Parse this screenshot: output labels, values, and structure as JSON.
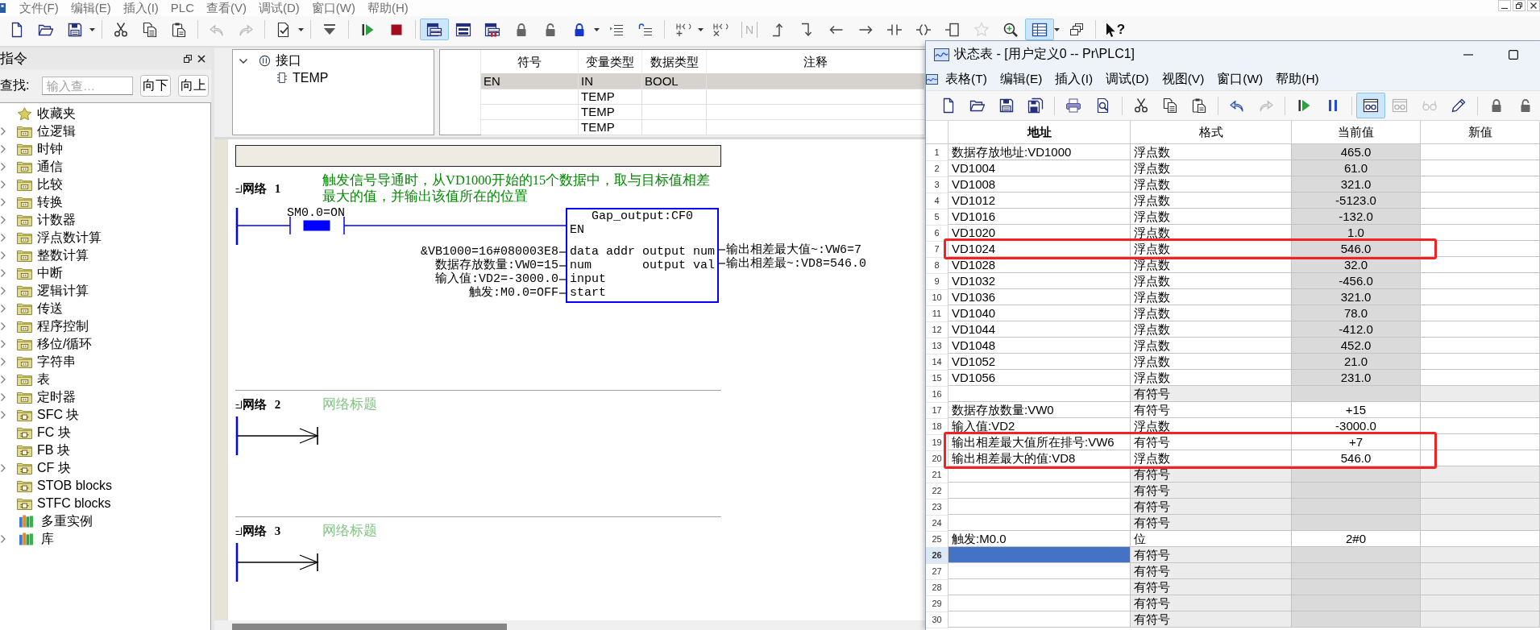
{
  "menu_bar": [
    "文件(F)",
    "编辑(E)",
    "插入(I)",
    "PLC",
    "查看(V)",
    "调试(D)",
    "窗口(W)",
    "帮助(H)"
  ],
  "toolbar": [
    [
      {
        "kind": "new",
        "pressed": false,
        "disabled": false,
        "dropdown": false
      },
      {
        "kind": "open",
        "pressed": false,
        "disabled": false,
        "dropdown": false
      },
      {
        "kind": "save",
        "pressed": false,
        "disabled": false,
        "dropdown": true
      }
    ],
    [
      {
        "kind": "cut",
        "pressed": false,
        "disabled": false,
        "dropdown": false
      },
      {
        "kind": "copy",
        "pressed": false,
        "disabled": false,
        "dropdown": false
      },
      {
        "kind": "paste",
        "pressed": false,
        "disabled": false,
        "dropdown": false
      }
    ],
    [
      {
        "kind": "undo",
        "pressed": false,
        "disabled": true,
        "dropdown": false
      },
      {
        "kind": "redo",
        "pressed": false,
        "disabled": true,
        "dropdown": false
      }
    ],
    [
      {
        "kind": "compile",
        "pressed": false,
        "disabled": false,
        "dropdown": true
      }
    ],
    [
      {
        "kind": "download",
        "pressed": false,
        "disabled": false,
        "dropdown": false
      }
    ],
    [
      {
        "kind": "run",
        "pressed": false,
        "disabled": false,
        "dropdown": false
      },
      {
        "kind": "stop",
        "pressed": false,
        "disabled": false,
        "dropdown": false
      }
    ],
    [
      {
        "kind": "listview",
        "pressed": true,
        "disabled": false,
        "dropdown": false
      },
      {
        "kind": "listview2",
        "pressed": false,
        "disabled": false,
        "dropdown": false
      },
      {
        "kind": "listforce",
        "pressed": false,
        "disabled": false,
        "dropdown": false
      },
      {
        "kind": "lock",
        "pressed": false,
        "disabled": false,
        "dropdown": false
      },
      {
        "kind": "unlock",
        "pressed": false,
        "disabled": false,
        "dropdown": false
      },
      {
        "kind": "protect",
        "pressed": false,
        "disabled": false,
        "dropdown": true
      },
      {
        "kind": "indent",
        "pressed": false,
        "disabled": false,
        "dropdown": false
      },
      {
        "kind": "outdent",
        "pressed": false,
        "disabled": false,
        "dropdown": false
      }
    ],
    [
      {
        "kind": "insertnet",
        "pressed": false,
        "disabled": false,
        "dropdown": true
      },
      {
        "kind": "deletenet",
        "pressed": false,
        "disabled": false,
        "dropdown": false
      },
      {
        "kind": "negate",
        "text": "N",
        "pressed": false,
        "disabled": true,
        "dropdown": false
      },
      {
        "kind": "branchup",
        "pressed": false,
        "disabled": false,
        "dropdown": false
      },
      {
        "kind": "branchdown",
        "pressed": false,
        "disabled": false,
        "dropdown": false
      },
      {
        "kind": "lineleft",
        "pressed": false,
        "disabled": false,
        "dropdown": false
      },
      {
        "kind": "lineright",
        "pressed": false,
        "disabled": false,
        "dropdown": false
      },
      {
        "kind": "contact",
        "pressed": false,
        "disabled": false,
        "dropdown": false
      },
      {
        "kind": "coil",
        "pressed": false,
        "disabled": false,
        "dropdown": false
      },
      {
        "kind": "box",
        "pressed": false,
        "disabled": false,
        "dropdown": false
      },
      {
        "kind": "star",
        "pressed": false,
        "disabled": true,
        "dropdown": false
      },
      {
        "kind": "zoom",
        "pressed": false,
        "disabled": false,
        "dropdown": false
      },
      {
        "kind": "table",
        "pressed": true,
        "disabled": false,
        "dropdown": true
      },
      {
        "kind": "windows",
        "pressed": false,
        "disabled": false,
        "dropdown": false
      }
    ],
    [
      {
        "kind": "help",
        "text": "?",
        "pressed": false,
        "disabled": false,
        "dropdown": false
      }
    ]
  ],
  "instructions": {
    "title": "指令",
    "search": {
      "label": "查找:",
      "placeholder": "输入查…"
    },
    "buttons": [
      "向下",
      "向上"
    ],
    "tree": [
      {
        "label": "收藏夹",
        "kind": "favorites",
        "expandable": false
      },
      {
        "label": "位逻辑",
        "kind": "folder",
        "expandable": true
      },
      {
        "label": "时钟",
        "kind": "folder",
        "expandable": true
      },
      {
        "label": "通信",
        "kind": "folder",
        "expandable": true
      },
      {
        "label": "比较",
        "kind": "folder",
        "expandable": true
      },
      {
        "label": "转换",
        "kind": "folder",
        "expandable": true
      },
      {
        "label": "计数器",
        "kind": "folder",
        "expandable": true
      },
      {
        "label": "浮点数计算",
        "kind": "folder",
        "expandable": true
      },
      {
        "label": "整数计算",
        "kind": "folder",
        "expandable": true
      },
      {
        "label": "中断",
        "kind": "folder",
        "expandable": true
      },
      {
        "label": "逻辑计算",
        "kind": "folder",
        "expandable": true
      },
      {
        "label": "传送",
        "kind": "folder",
        "expandable": true
      },
      {
        "label": "程序控制",
        "kind": "folder",
        "expandable": true
      },
      {
        "label": "移位/循环",
        "kind": "folder",
        "expandable": true
      },
      {
        "label": "字符串",
        "kind": "folder",
        "expandable": true
      },
      {
        "label": "表",
        "kind": "folder",
        "expandable": true
      },
      {
        "label": "定时器",
        "kind": "folder",
        "expandable": true
      },
      {
        "label": "SFC 块",
        "kind": "block",
        "expandable": true
      },
      {
        "label": "FC 块",
        "kind": "block",
        "expandable": false
      },
      {
        "label": "FB 块",
        "kind": "block",
        "expandable": false
      },
      {
        "label": "CF 块",
        "kind": "block",
        "expandable": true
      },
      {
        "label": "STOB blocks",
        "kind": "block",
        "expandable": false
      },
      {
        "label": "STFC blocks",
        "kind": "block",
        "expandable": false
      },
      {
        "label": "多重实例",
        "kind": "library",
        "expandable": false
      },
      {
        "label": "库",
        "kind": "library",
        "expandable": true
      }
    ]
  },
  "interface": {
    "tree": {
      "label": "接口",
      "expanded": true,
      "children": [
        {
          "label": "TEMP"
        }
      ]
    },
    "columns": [
      "符号",
      "变量类型",
      "数据类型",
      "注释"
    ],
    "rows": [
      {
        "symbol": "EN",
        "var_type": "IN",
        "data_type": "BOOL",
        "selected": true
      },
      {
        "var_type": "TEMP",
        "selected": false
      },
      {
        "var_type": "TEMP",
        "selected": false
      },
      {
        "var_type": "TEMP",
        "selected": false
      }
    ]
  },
  "ladder": {
    "networks": [
      {
        "kind": "block",
        "label": "网络 1",
        "title": "触发信号导通时，从VD1000开始的15个数据中，取与目标值相差最大的值，并输出该值所在的位置",
        "contact": {
          "label": "SM0.0=ON",
          "energized": true
        },
        "block": {
          "title": "Gap_output:CF0",
          "enable": "EN",
          "inputs": [
            {
              "pin": "data addr",
              "operand": "&VB1000=16#080003E8"
            },
            {
              "pin": "num",
              "operand": "数据存放数量:VW0=15"
            },
            {
              "pin": "input",
              "operand": "输入值:VD2=-3000.0"
            },
            {
              "pin": "start",
              "operand": "触发:M0.0=OFF"
            }
          ],
          "outputs": [
            {
              "pin": "output num",
              "operand": "输出相差最大值~:VW6=7"
            },
            {
              "pin": "output val",
              "operand": "输出相差最~:VD8=546.0"
            }
          ]
        }
      },
      {
        "kind": "empty",
        "label": "网络 2",
        "placeholder": "网络标题"
      },
      {
        "kind": "empty",
        "label": "网络 3",
        "placeholder": "网络标题"
      }
    ]
  },
  "status_window": {
    "title": "状态表 - [用户定义0 -- Pr\\PLC1]",
    "menu": [
      "表格(T)",
      "编辑(E)",
      "插入(I)",
      "调试(D)",
      "视图(V)",
      "窗口(W)",
      "帮助(H)"
    ],
    "toolbar": [
      [
        {
          "kind": "new",
          "pressed": false,
          "disabled": false,
          "dropdown": false
        },
        {
          "kind": "open",
          "pressed": false,
          "disabled": false,
          "dropdown": false
        },
        {
          "kind": "save",
          "pressed": false,
          "disabled": false,
          "dropdown": false
        },
        {
          "kind": "saveall",
          "pressed": false,
          "disabled": false,
          "dropdown": false
        }
      ],
      [
        {
          "kind": "print",
          "pressed": false,
          "disabled": false,
          "dropdown": false
        },
        {
          "kind": "preview",
          "pressed": false,
          "disabled": false,
          "dropdown": false
        }
      ],
      [
        {
          "kind": "cut",
          "pressed": false,
          "disabled": false,
          "dropdown": false
        },
        {
          "kind": "copy",
          "pressed": false,
          "disabled": false,
          "dropdown": false
        },
        {
          "kind": "paste",
          "pressed": false,
          "disabled": false,
          "dropdown": false
        }
      ],
      [
        {
          "kind": "undo",
          "pressed": false,
          "disabled": false,
          "dropdown": false
        },
        {
          "kind": "redo",
          "pressed": false,
          "disabled": true,
          "dropdown": false
        }
      ],
      [
        {
          "kind": "run",
          "pressed": false,
          "disabled": false,
          "dropdown": false
        },
        {
          "kind": "pause",
          "pressed": false,
          "disabled": false,
          "dropdown": false
        }
      ],
      [
        {
          "kind": "chart",
          "pressed": true,
          "disabled": false,
          "dropdown": false
        },
        {
          "kind": "singleread",
          "pressed": false,
          "disabled": true,
          "dropdown": false
        },
        {
          "kind": "glasses",
          "pressed": false,
          "disabled": true,
          "dropdown": false
        },
        {
          "kind": "write",
          "pressed": false,
          "disabled": false,
          "dropdown": false
        }
      ],
      [
        {
          "kind": "lock",
          "pressed": false,
          "disabled": false,
          "dropdown": false
        },
        {
          "kind": "unlock",
          "pressed": false,
          "disabled": false,
          "dropdown": false
        }
      ]
    ],
    "columns": [
      {
        "label": "地址",
        "selected": true
      },
      {
        "label": "格式",
        "selected": false
      },
      {
        "label": "当前值",
        "selected": false
      },
      {
        "label": "新值",
        "selected": false
      }
    ],
    "rows": [
      {
        "number": "1",
        "kind": "entry",
        "address": "数据存放地址:VD1000",
        "format": "浮点数",
        "value": "465.0",
        "value_shaded": true,
        "highlighted": false,
        "selected": false
      },
      {
        "number": "2",
        "kind": "entry",
        "address": "VD1004",
        "format": "浮点数",
        "value": "61.0",
        "value_shaded": true,
        "highlighted": false,
        "selected": false
      },
      {
        "number": "3",
        "kind": "entry",
        "address": "VD1008",
        "format": "浮点数",
        "value": "321.0",
        "value_shaded": true,
        "highlighted": false,
        "selected": false
      },
      {
        "number": "4",
        "kind": "entry",
        "address": "VD1012",
        "format": "浮点数",
        "value": "-5123.0",
        "value_shaded": true,
        "highlighted": false,
        "selected": false
      },
      {
        "number": "5",
        "kind": "entry",
        "address": "VD1016",
        "format": "浮点数",
        "value": "-132.0",
        "value_shaded": true,
        "highlighted": false,
        "selected": false
      },
      {
        "number": "6",
        "kind": "entry",
        "address": "VD1020",
        "format": "浮点数",
        "value": "1.0",
        "value_shaded": true,
        "highlighted": false,
        "selected": false
      },
      {
        "number": "7",
        "kind": "entry",
        "address": "VD1024",
        "format": "浮点数",
        "value": "546.0",
        "value_shaded": true,
        "highlighted": true,
        "selected": false
      },
      {
        "number": "8",
        "kind": "entry",
        "address": "VD1028",
        "format": "浮点数",
        "value": "32.0",
        "value_shaded": true,
        "highlighted": false,
        "selected": false
      },
      {
        "number": "9",
        "kind": "entry",
        "address": "VD1032",
        "format": "浮点数",
        "value": "-456.0",
        "value_shaded": true,
        "highlighted": false,
        "selected": false
      },
      {
        "number": "10",
        "kind": "entry",
        "address": "VD1036",
        "format": "浮点数",
        "value": "321.0",
        "value_shaded": true,
        "highlighted": false,
        "selected": false
      },
      {
        "number": "11",
        "kind": "entry",
        "address": "VD1040",
        "format": "浮点数",
        "value": "78.0",
        "value_shaded": true,
        "highlighted": false,
        "selected": false
      },
      {
        "number": "12",
        "kind": "entry",
        "address": "VD1044",
        "format": "浮点数",
        "value": "-412.0",
        "value_shaded": true,
        "highlighted": false,
        "selected": false
      },
      {
        "number": "13",
        "kind": "entry",
        "address": "VD1048",
        "format": "浮点数",
        "value": "452.0",
        "value_shaded": true,
        "highlighted": false,
        "selected": false
      },
      {
        "number": "14",
        "kind": "entry",
        "address": "VD1052",
        "format": "浮点数",
        "value": "21.0",
        "value_shaded": true,
        "highlighted": false,
        "selected": false
      },
      {
        "number": "15",
        "kind": "entry",
        "address": "VD1056",
        "format": "浮点数",
        "value": "231.0",
        "value_shaded": true,
        "highlighted": false,
        "selected": false
      },
      {
        "number": "16",
        "kind": "blank",
        "format": "有符号",
        "value_shaded": true,
        "highlighted": false,
        "selected": false
      },
      {
        "number": "17",
        "kind": "entry",
        "address": "数据存放数量:VW0",
        "format": "有符号",
        "value": "+15",
        "value_shaded": false,
        "highlighted": false,
        "selected": false
      },
      {
        "number": "18",
        "kind": "entry",
        "address": "输入值:VD2",
        "format": "浮点数",
        "value": "-3000.0",
        "value_shaded": false,
        "highlighted": false,
        "selected": false
      },
      {
        "number": "19",
        "kind": "entry",
        "address": "输出相差最大值所在排号:VW6",
        "format": "有符号",
        "value": "+7",
        "value_shaded": false,
        "highlighted": true,
        "selected": false
      },
      {
        "number": "20",
        "kind": "entry",
        "address": "输出相差最大的值:VD8",
        "format": "浮点数",
        "value": "546.0",
        "value_shaded": false,
        "highlighted": true,
        "selected": false
      },
      {
        "number": "21",
        "kind": "blank",
        "format": "有符号",
        "value_shaded": true,
        "highlighted": false,
        "selected": false
      },
      {
        "number": "22",
        "kind": "blank",
        "format": "有符号",
        "value_shaded": true,
        "highlighted": false,
        "selected": false
      },
      {
        "number": "23",
        "kind": "blank",
        "format": "有符号",
        "value_shaded": true,
        "highlighted": false,
        "selected": false
      },
      {
        "number": "24",
        "kind": "blank",
        "format": "有符号",
        "value_shaded": true,
        "highlighted": false,
        "selected": false
      },
      {
        "number": "25",
        "kind": "entry",
        "address": "触发:M0.0",
        "format": "位",
        "value": "2#0",
        "value_shaded": false,
        "highlighted": false,
        "selected": false
      },
      {
        "number": "26",
        "kind": "blank",
        "format": "有符号",
        "value_shaded": true,
        "highlighted": false,
        "selected": true
      },
      {
        "number": "27",
        "kind": "blank",
        "format": "有符号",
        "value_shaded": true,
        "highlighted": false,
        "selected": false
      },
      {
        "number": "28",
        "kind": "blank",
        "format": "有符号",
        "value_shaded": true,
        "highlighted": false,
        "selected": false
      },
      {
        "number": "29",
        "kind": "blank",
        "format": "有符号",
        "value_shaded": true,
        "highlighted": false,
        "selected": false
      },
      {
        "number": "30",
        "kind": "blank",
        "format": "有符号",
        "value_shaded": true,
        "highlighted": false,
        "selected": false
      }
    ]
  }
}
